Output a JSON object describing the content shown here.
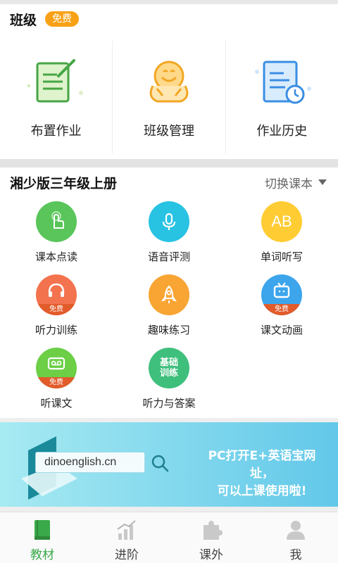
{
  "class_section": {
    "title": "班级",
    "badge": "免费",
    "items": [
      {
        "label": "布置作业",
        "icon": "assign-homework-icon"
      },
      {
        "label": "班级管理",
        "icon": "class-management-icon"
      },
      {
        "label": "作业历史",
        "icon": "homework-history-icon"
      }
    ]
  },
  "book_section": {
    "title": "湘少版三年级上册",
    "switch_label": "切换课本",
    "items": [
      {
        "label": "课本点读",
        "icon": "tap-read-icon",
        "color": "#59c55a"
      },
      {
        "label": "语音评测",
        "icon": "microphone-icon",
        "color": "#28c2e3"
      },
      {
        "label": "单词听写",
        "icon": "ab-letters-icon",
        "icon_text": "AB",
        "color": "#ffcc33"
      },
      {
        "label": "听力训练",
        "icon": "headphones-icon",
        "badge": "免费",
        "color": "#f3734e"
      },
      {
        "label": "趣味练习",
        "icon": "rocket-icon",
        "color": "#f8a533"
      },
      {
        "label": "课文动画",
        "icon": "tv-icon",
        "badge": "免费",
        "color": "#3ca5ec"
      },
      {
        "label": "听课文",
        "icon": "cassette-icon",
        "badge": "免费",
        "color": "#6ccf46"
      },
      {
        "label": "听力与答案",
        "icon": "basic-training-icon",
        "icon_text": "基础\n训练",
        "color": "#3fbf7c"
      }
    ]
  },
  "banner": {
    "url": "dinoenglish.cn",
    "promo_line1": "PC打开E+英语宝网址，",
    "promo_line2": "可以上课使用啦!"
  },
  "bottom_nav": [
    {
      "label": "教材",
      "icon": "textbook-icon",
      "active": true
    },
    {
      "label": "进阶",
      "icon": "bar-chart-icon"
    },
    {
      "label": "课外",
      "icon": "puzzle-icon"
    },
    {
      "label": "我",
      "icon": "user-icon"
    }
  ],
  "colors": {
    "accent_green": "#3aa94a",
    "badge_orange": "#f9a116"
  }
}
